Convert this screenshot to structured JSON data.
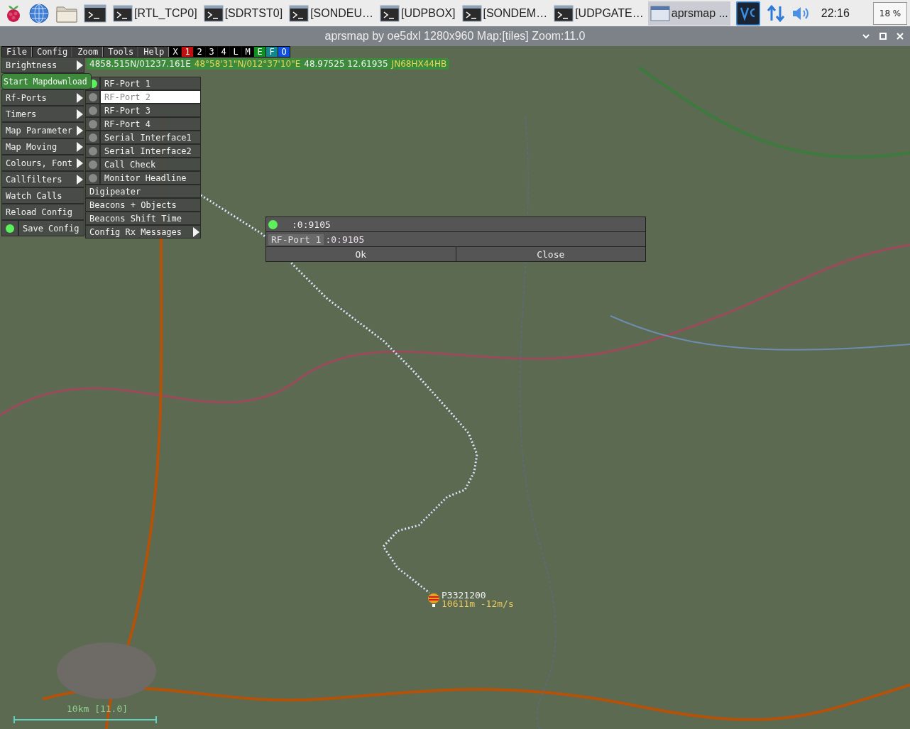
{
  "taskbar": {
    "tasks": [
      {
        "label": "[RTL_TCP0]",
        "kind": "terminal",
        "selected": false
      },
      {
        "label": "[SDRTST0]",
        "kind": "terminal",
        "selected": false
      },
      {
        "label": "[SONDEU…",
        "kind": "terminal",
        "selected": false
      },
      {
        "label": "[UDPBOX]",
        "kind": "terminal",
        "selected": false
      },
      {
        "label": "[SONDEM…",
        "kind": "terminal",
        "selected": false
      },
      {
        "label": "[UDPGATE…",
        "kind": "terminal",
        "selected": false
      },
      {
        "label": "aprsmap ...",
        "kind": "window",
        "selected": true
      }
    ],
    "clock": "22:16",
    "cpu": "18 %"
  },
  "window": {
    "title": "aprsmap by oe5dxl 1280x960 Map:[tiles] Zoom:11.0"
  },
  "menu_bar": {
    "items": [
      "File",
      "Config",
      "Zoom",
      "Tools",
      "Help"
    ],
    "toggles": [
      {
        "label": "X",
        "color": "#000000"
      },
      {
        "label": "1",
        "color": "#c01010"
      },
      {
        "label": "2",
        "color": "#000000"
      },
      {
        "label": "3",
        "color": "#000000"
      },
      {
        "label": "4",
        "color": "#000000"
      },
      {
        "label": "L",
        "color": "#000000"
      },
      {
        "label": "M",
        "color": "#000000"
      },
      {
        "label": "E",
        "color": "#109020"
      },
      {
        "label": "F",
        "color": "#108890"
      },
      {
        "label": "O",
        "color": "#1050e0"
      }
    ]
  },
  "position_line": [
    {
      "text": "4858.515N/01237.161E",
      "kind": "plain"
    },
    {
      "text": "48°58'31\"N/012°37'10\"E",
      "kind": "highlight"
    },
    {
      "text": "48.97525 12.61935",
      "kind": "plain"
    },
    {
      "text": "JN68HX44HB",
      "kind": "highlight"
    }
  ],
  "main_menu": [
    {
      "label": "Brightness",
      "kind": "submenu"
    },
    {
      "label": "Start Mapdownload",
      "kind": "highlight"
    },
    {
      "label": "Rf-Ports",
      "kind": "submenu"
    },
    {
      "label": "Timers",
      "kind": "submenu"
    },
    {
      "label": "Map Parameter",
      "kind": "submenu"
    },
    {
      "label": "Map Moving",
      "kind": "submenu"
    },
    {
      "label": "Colours, Font",
      "kind": "submenu"
    },
    {
      "label": "Callfilters",
      "kind": "submenu"
    },
    {
      "label": "Watch Calls",
      "kind": "action"
    },
    {
      "label": "Reload Config",
      "kind": "action"
    },
    {
      "label": "Save Config",
      "kind": "dot",
      "on": true
    }
  ],
  "rf_ports_menu": [
    {
      "label": "RF-Port 1",
      "kind": "dot",
      "on": true,
      "selected": false
    },
    {
      "label": "RF-Port 2",
      "kind": "dot",
      "on": false,
      "selected": true
    },
    {
      "label": "RF-Port 3",
      "kind": "dot",
      "on": false,
      "selected": false
    },
    {
      "label": "RF-Port 4",
      "kind": "dot",
      "on": false,
      "selected": false
    },
    {
      "label": "Serial Interface1",
      "kind": "dot",
      "on": false,
      "selected": false
    },
    {
      "label": "Serial Interface2",
      "kind": "dot",
      "on": false,
      "selected": false
    },
    {
      "label": "Call Check",
      "kind": "dot",
      "on": false,
      "selected": false
    },
    {
      "label": "Monitor Headline",
      "kind": "dot",
      "on": false,
      "selected": false
    },
    {
      "label": "Digipeater",
      "kind": "action",
      "selected": false
    },
    {
      "label": "Beacons + Objects",
      "kind": "action",
      "selected": false
    },
    {
      "label": "Beacons Shift Time",
      "kind": "action",
      "selected": false
    },
    {
      "label": "Config Rx Messages",
      "kind": "submenu",
      "selected": false
    }
  ],
  "dialog": {
    "status_on": true,
    "status_text": ":0:9105",
    "port_label": "RF-Port 1",
    "port_value": ":0:9105",
    "buttons": [
      "Ok",
      "Close"
    ]
  },
  "balloon": {
    "callsign": "P3321200",
    "info": "10611m -12m/s"
  },
  "scale": {
    "label": "10km [11.0]"
  }
}
